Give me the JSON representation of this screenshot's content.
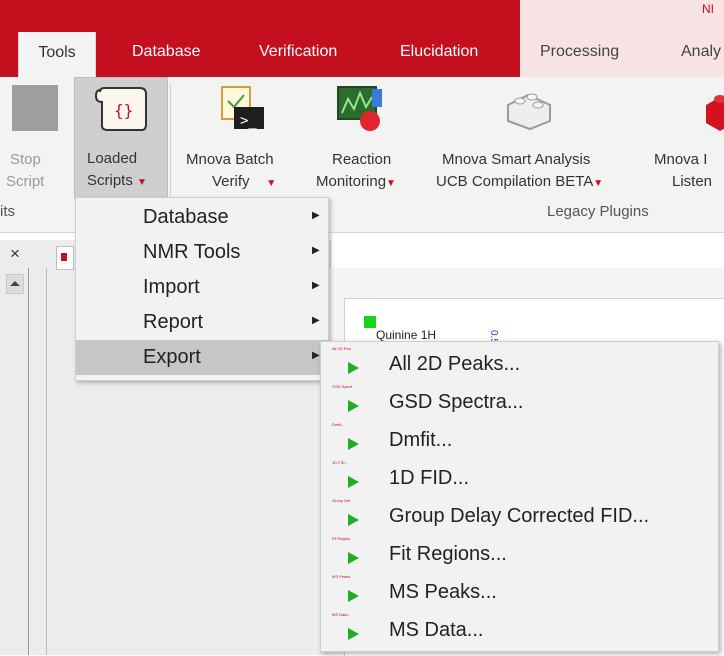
{
  "window": {
    "title_fragment": "NI"
  },
  "tabs": [
    {
      "label": "Tools",
      "active": true
    },
    {
      "label": "Database"
    },
    {
      "label": "Verification"
    },
    {
      "label": "Elucidation"
    },
    {
      "label": "Processing"
    },
    {
      "label": "Analy"
    }
  ],
  "ribbon": {
    "stop_script": [
      "Stop",
      "Script"
    ],
    "loaded_scripts": [
      "Loaded",
      "Scripts"
    ],
    "mnova_batch_verify": [
      "Mnova Batch",
      "Verify"
    ],
    "reaction_monitoring": [
      "Reaction",
      "Monitoring"
    ],
    "smart_analysis": [
      "Mnova Smart Analysis",
      "UCB Compilation BETA"
    ],
    "mnova_listener": [
      "Mnova I",
      "Listen"
    ],
    "group_left": "its",
    "group_legacy": "Legacy Plugins"
  },
  "loaded_scripts_menu": [
    {
      "label": "Database"
    },
    {
      "label": "NMR Tools"
    },
    {
      "label": "Import"
    },
    {
      "label": "Report"
    },
    {
      "label": "Export",
      "highlighted": true
    }
  ],
  "export_submenu": [
    {
      "label": "All 2D Peaks...",
      "thumb": "All 2D Pea"
    },
    {
      "label": "GSD Spectra...",
      "thumb": "GSD Spect"
    },
    {
      "label": "Dmfit...",
      "thumb": "Dmfit..."
    },
    {
      "label": "1D FID...",
      "thumb": "1D FID..."
    },
    {
      "label": "Group Delay Corrected FID...",
      "thumb": "Group Del"
    },
    {
      "label": "Fit Regions...",
      "thumb": "Fit Region"
    },
    {
      "label": "MS Peaks...",
      "thumb": "MS Peaks"
    },
    {
      "label": "MS Data...",
      "thumb": "MS Data.."
    }
  ],
  "panel": {
    "close_glyph": "×"
  },
  "spectrum": {
    "title": "Quinine 1H",
    "tick": "0.5"
  },
  "colors": {
    "accent_red": "#c40f1f",
    "play_green": "#1fae1f",
    "marker_green": "#19d419"
  }
}
